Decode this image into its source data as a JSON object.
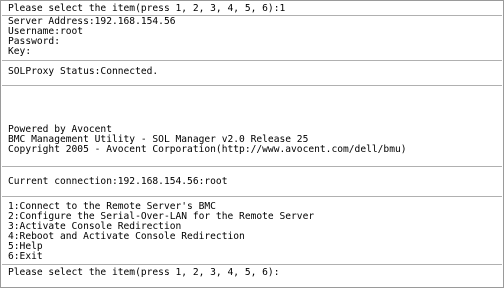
{
  "console": {
    "prompt_top": "Please select the item(press 1, 2, 3, 4, 5, 6):1",
    "server_address": "Server Address:192.168.154.56",
    "username": "Username:root",
    "password": "Password:",
    "key": "Key:",
    "status": "SOLProxy Status:Connected.",
    "powered_by": "Powered by Avocent",
    "product": "BMC Management Utility - SOL Manager v2.0 Release 25",
    "copyright": "Copyright 2005 - Avocent Corporation(http://www.avocent.com/dell/bmu)",
    "current_connection": "Current connection:192.168.154.56:root",
    "menu": [
      "1:Connect to the Remote Server's BMC",
      "2:Configure the Serial-Over-LAN for the Remote Server",
      "3:Activate Console Redirection",
      "4:Reboot and Activate Console Redirection",
      "5:Help",
      "6:Exit"
    ],
    "prompt_bottom": "Please select the item(press 1, 2, 3, 4, 5, 6):"
  }
}
